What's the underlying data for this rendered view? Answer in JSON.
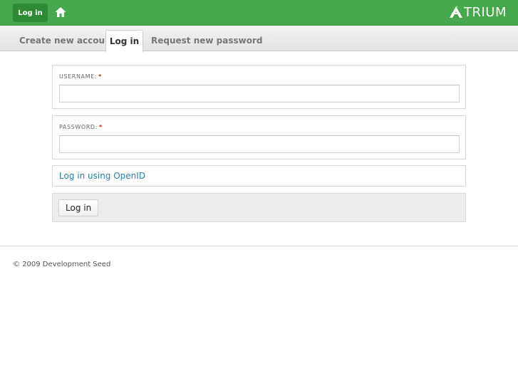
{
  "topbar": {
    "login_label": "Log in",
    "logo_text": "TRIUM",
    "brand_color": "#45a84d",
    "icons": {
      "home": "home-icon",
      "logo_mark": "atrium-logo-icon"
    }
  },
  "tabs": [
    {
      "label": "Create new account",
      "active": false
    },
    {
      "label": "Log in",
      "active": true
    },
    {
      "label": "Request new password",
      "active": false
    }
  ],
  "form": {
    "username": {
      "label": "USERNAME:",
      "required_marker": "*",
      "value": ""
    },
    "password": {
      "label": "PASSWORD:",
      "required_marker": "*",
      "value": ""
    },
    "openid_link": "Log in using OpenID",
    "submit_label": "Log in"
  },
  "footer": {
    "text": "© 2009 Development Seed"
  }
}
